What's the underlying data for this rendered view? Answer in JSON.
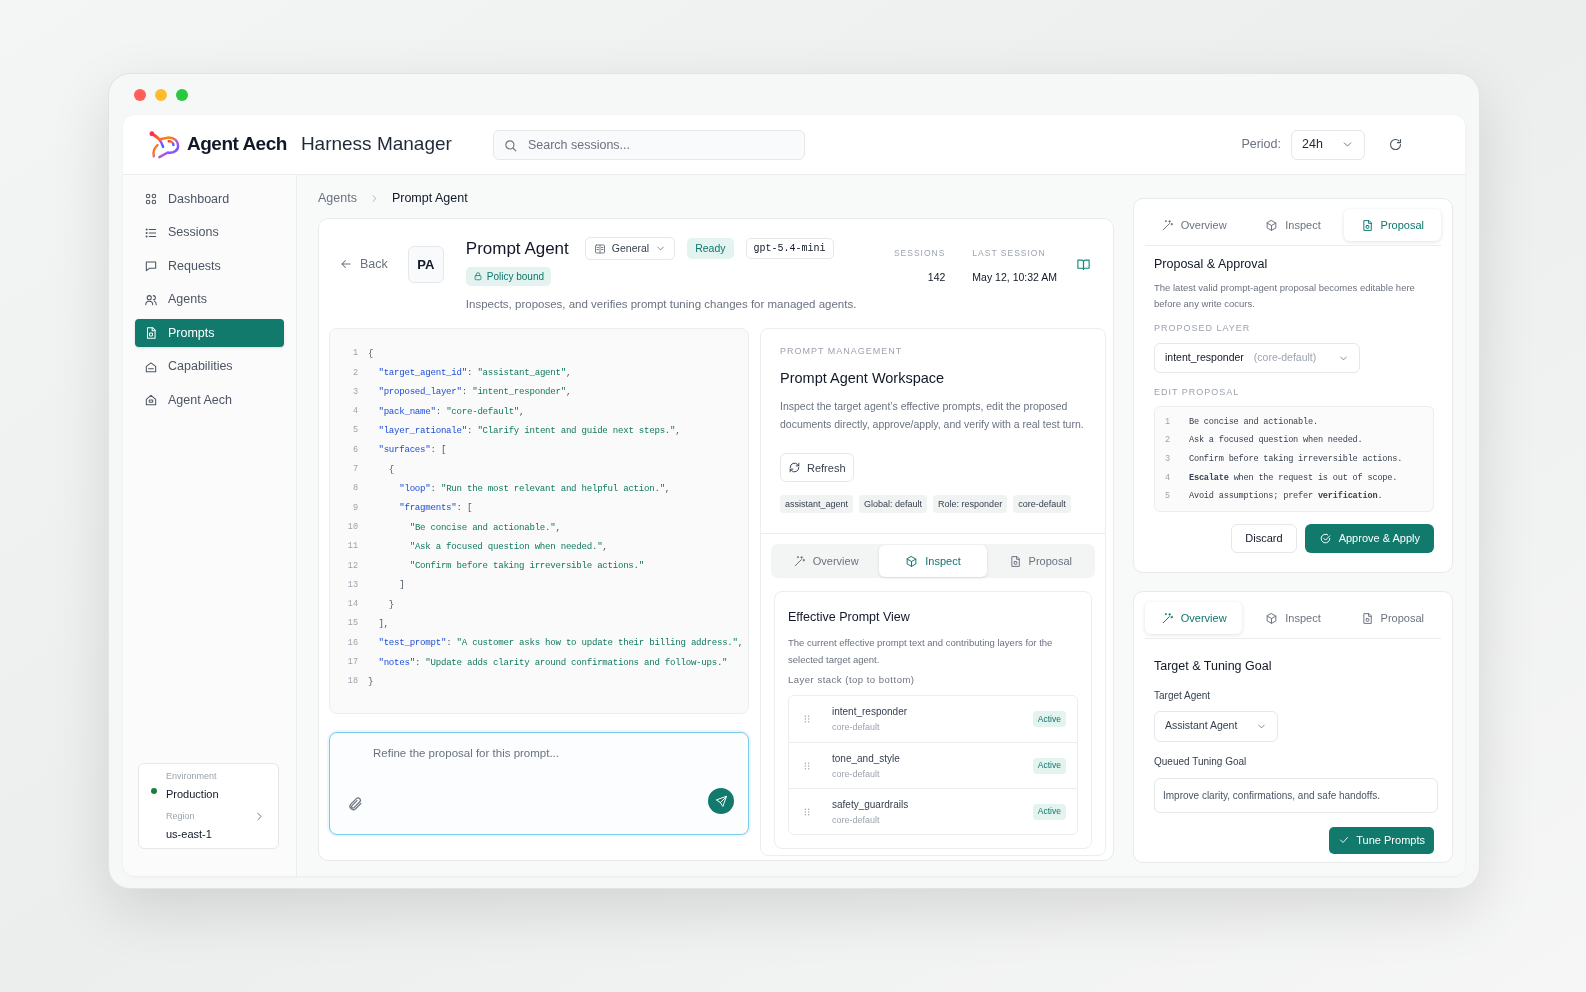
{
  "header": {
    "brand": "Agent Aech",
    "title": "Harness Manager",
    "search": {
      "placeholder": "Search sessions..."
    },
    "period": {
      "label": "Period:",
      "value": "24h"
    }
  },
  "sidebar": {
    "items": [
      {
        "label": "Dashboard",
        "selected": false
      },
      {
        "label": "Sessions",
        "selected": false
      },
      {
        "label": "Requests",
        "selected": false
      },
      {
        "label": "Agents",
        "selected": false
      },
      {
        "label": "Prompts",
        "selected": true
      },
      {
        "label": "Capabilities",
        "selected": false
      },
      {
        "label": "Agent Aech",
        "selected": false
      }
    ],
    "environment": {
      "label": "Environment",
      "value": "Production",
      "region_label": "Region",
      "region": "us-east-1"
    }
  },
  "breadcrumb": [
    "Agents",
    "Prompt Agent"
  ],
  "agent": {
    "back": "Back",
    "initials": "PA",
    "name": "Prompt Agent",
    "category": "General",
    "status": "Ready",
    "model": "gpt-5.4-mini",
    "policy": "Policy bound",
    "description": "Inspects, proposes, and verifies prompt tuning changes for managed agents.",
    "stats": [
      {
        "label": "SESSIONS",
        "value": "142"
      },
      {
        "label": "LAST SESSION",
        "value": "May 12, 10:32 AM"
      }
    ]
  },
  "editor": {
    "lines": [
      {
        "number": "1",
        "code": "{"
      },
      {
        "number": "2",
        "code": "  \"target_agent_id\": \"assistant_agent\","
      },
      {
        "number": "3",
        "code": "  \"proposed_layer\": \"intent_responder\","
      },
      {
        "number": "4",
        "code": "  \"pack_name\": \"core-default\","
      },
      {
        "number": "5",
        "code": "  \"layer_rationale\": \"Clarify intent and guide next steps.\","
      },
      {
        "number": "6",
        "code": "  \"surfaces\": ["
      },
      {
        "number": "7",
        "code": "    {"
      },
      {
        "number": "8",
        "code": "      \"loop\": \"Run the most relevant and helpful action.\","
      },
      {
        "number": "9",
        "code": "      \"fragments\": ["
      },
      {
        "number": "10",
        "code": "        \"Be concise and actionable.\","
      },
      {
        "number": "11",
        "code": "        \"Ask a focused question when needed.\","
      },
      {
        "number": "12",
        "code": "        \"Confirm before taking irreversible actions.\""
      },
      {
        "number": "13",
        "code": "      ]"
      },
      {
        "number": "14",
        "code": "    }"
      },
      {
        "number": "15",
        "code": "  ],"
      },
      {
        "number": "16",
        "code": "  \"test_prompt\": \"A customer asks how to update their billing address.\","
      },
      {
        "number": "17",
        "code": "  \"notes\": \"Update adds clarity around confirmations and follow-ups.\""
      },
      {
        "number": "18",
        "code": "}"
      }
    ]
  },
  "composer": {
    "placeholder": "Refine the proposal for this prompt..."
  },
  "workspace": {
    "eyebrow": "PROMPT MANAGEMENT",
    "title": "Prompt Agent Workspace",
    "description": "Inspect the target agent’s effective prompts, edit the proposed documents directly, approve/apply, and verify with a real test turn.",
    "refresh": "Refresh",
    "tags": [
      "assistant_agent",
      "Global: default",
      "Role: responder",
      "core-default"
    ],
    "tabs": [
      {
        "label": "Overview",
        "selected": false
      },
      {
        "label": "Inspect",
        "selected": true
      },
      {
        "label": "Proposal",
        "selected": false
      }
    ],
    "view": {
      "title": "Effective Prompt View",
      "description": "The current effective prompt text and contributing layers for the selected target agent.",
      "stack_label": "Layer stack (top to bottom)",
      "layers": [
        {
          "name": "intent_responder",
          "pack": "core-default",
          "status": "Active"
        },
        {
          "name": "tone_and_style",
          "pack": "core-default",
          "status": "Active"
        },
        {
          "name": "safety_guardrails",
          "pack": "core-default",
          "status": "Active"
        }
      ]
    }
  },
  "proposal_panel": {
    "tabs": [
      {
        "label": "Overview",
        "selected": false
      },
      {
        "label": "Inspect",
        "selected": false
      },
      {
        "label": "Proposal",
        "selected": true
      }
    ],
    "title": "Proposal & Approval",
    "description": "The latest valid prompt-agent proposal becomes editable here before any write cocurs.",
    "layer_label": "PROPOSED LAYER",
    "layer": {
      "value": "intent_responder",
      "pack": "(core-default)"
    },
    "edit_label": "EDIT PROPOSAL",
    "lines": [
      {
        "number": "1",
        "text": "Be concise and actionable."
      },
      {
        "number": "2",
        "text": "Ask a focused question when needed."
      },
      {
        "number": "3",
        "text": "Confirm before taking irreversible actions."
      },
      {
        "number": "4",
        "text": "**Escalate** when the request is out of scope."
      },
      {
        "number": "5",
        "text": "Avoid assumptions; prefer **verification**."
      }
    ],
    "discard": "Discard",
    "approve": "Approve & Apply"
  },
  "goal_panel": {
    "tabs": [
      {
        "label": "Overview",
        "selected": true
      },
      {
        "label": "Inspect",
        "selected": false
      },
      {
        "label": "Proposal",
        "selected": false
      }
    ],
    "title": "Target & Tuning Goal",
    "target_label": "Target Agent",
    "target": "Assistant Agent",
    "goal_label": "Queued Tuning Goal",
    "goal": "Improve clarity, confirmations, and safe handoffs.",
    "submit": "Tune Prompts"
  }
}
